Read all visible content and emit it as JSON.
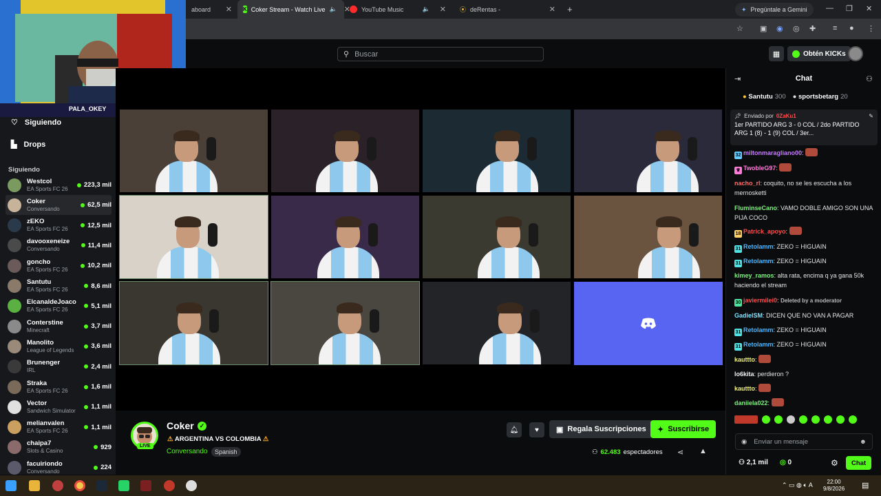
{
  "browser": {
    "tabs": [
      {
        "label": "aboard"
      },
      {
        "label": "Coker Stream - Watch Live"
      },
      {
        "label": "YouTube Music"
      },
      {
        "label": "deRentas -"
      }
    ],
    "gemini_label": "Pregúntale a Gemini"
  },
  "webcam": {
    "handle": "PALA_OKEY"
  },
  "header": {
    "search_placeholder": "Buscar",
    "kicks_button": "Obtén KICKs"
  },
  "sidebar": {
    "nav": [
      {
        "label": "Siguiendo"
      },
      {
        "label": "Drops"
      }
    ],
    "section_title": "Siguiendo",
    "following": [
      {
        "name": "Westcol",
        "category": "EA Sports FC 26",
        "viewers": "223,3 mil",
        "color": "#7a9a60"
      },
      {
        "name": "Coker",
        "category": "Conversando",
        "viewers": "62,5 mil",
        "color": "#c7b29a"
      },
      {
        "name": "zEKO",
        "category": "EA Sports FC 26",
        "viewers": "12,5 mil",
        "color": "#2a3a4a"
      },
      {
        "name": "davooxeneize",
        "category": "Conversando",
        "viewers": "11,4 mil",
        "color": "#4a4a4a"
      },
      {
        "name": "goncho",
        "category": "EA Sports FC 26",
        "viewers": "10,2 mil",
        "color": "#6a5a5a"
      },
      {
        "name": "Santutu",
        "category": "EA Sports FC 26",
        "viewers": "8,6 mil",
        "color": "#8a7a6a"
      },
      {
        "name": "ElcanaldeJoaco",
        "category": "EA Sports FC 26",
        "viewers": "5,1 mil",
        "color": "#5ab040"
      },
      {
        "name": "Conterstine",
        "category": "Minecraft",
        "viewers": "3,7 mil",
        "color": "#8a8a8a"
      },
      {
        "name": "Manolito",
        "category": "League of Legends",
        "viewers": "3,6 mil",
        "color": "#9a8a7a"
      },
      {
        "name": "Brunenger",
        "category": "IRL",
        "viewers": "2,4 mil",
        "color": "#3a3a3a"
      },
      {
        "name": "Straka",
        "category": "EA Sports FC 26",
        "viewers": "1,6 mil",
        "color": "#7a6a5a"
      },
      {
        "name": "Vector",
        "category": "Sandwich Simulator",
        "viewers": "1,1 mil",
        "color": "#e0e0e0"
      },
      {
        "name": "melianvalen",
        "category": "EA Sports FC 26",
        "viewers": "1,1 mil",
        "color": "#c9a060"
      },
      {
        "name": "chaipa7",
        "category": "Slots & Casino",
        "viewers": "929",
        "color": "#8a6a6a"
      },
      {
        "name": "facuiriondo",
        "category": "Conversando",
        "viewers": "224",
        "color": "#5a5a6a"
      }
    ]
  },
  "channel": {
    "name": "Coker",
    "live_badge": "LIVE",
    "title": "ARGENTINA VS COLOMBIA",
    "category": "Conversando",
    "language": "Spanish",
    "gift_button": "Regala Suscripciones",
    "subscribe_button": "Suscribirse",
    "viewers": "62.483",
    "viewers_label": "espectadores"
  },
  "chat": {
    "title": "Chat",
    "gifters": [
      {
        "name": "Santutu",
        "count": "300"
      },
      {
        "name": "sportsbetarg",
        "count": "20"
      }
    ],
    "pinned": {
      "sent_by_label": "Enviado por",
      "user": "0ZaKu1",
      "text": "1er PARTIDO ARG 3 - 0 COL / 2do PARTIDO ARG 1 (8) - 1 (9) COL / 3er..."
    },
    "messages": [
      {
        "user": "miltonmaragliano00",
        "text": "",
        "color": "#c77dff",
        "badge": "32",
        "badge_color": "#6cf"
      },
      {
        "user": "TwobleG97",
        "text": "",
        "color": "#ff7ad9",
        "badge": "♕",
        "badge_color": "#ff7ad9"
      },
      {
        "user": "nacho_rl",
        "text": "coquito, no se les escucha a los mernosketti",
        "color": "#ff6b6b",
        "badge": "",
        "badge_color": ""
      },
      {
        "user": "FluminseCano",
        "text": "VAMO DOBLE AMIGO SON UNA PIJA COCO",
        "color": "#7cf27c",
        "badge": "",
        "badge_color": ""
      },
      {
        "user": "Patrick_apoyo",
        "text": "",
        "color": "#ff4d4d",
        "badge": "18",
        "badge_color": "#ffd166"
      },
      {
        "user": "Retolamm",
        "text": "ZEKO = HIGUAIN",
        "color": "#4db8ff",
        "badge": "31",
        "badge_color": "#4fe3e3"
      },
      {
        "user": "Retolamm",
        "text": "ZEKO = HIGUAIN",
        "color": "#4db8ff",
        "badge": "31",
        "badge_color": "#4fe3e3"
      },
      {
        "user": "kimey_ramos",
        "text": "alta rata, encima q ya gana 50k haciendo el stream",
        "color": "#7cf27c",
        "badge": "",
        "badge_color": ""
      },
      {
        "user": "javiermilei0",
        "text": "Deleted by a moderator",
        "color": "#ff4d4d",
        "badge": "30",
        "badge_color": "#4fe3a0"
      },
      {
        "user": "GadielSM",
        "text": "DICEN QUE NO VAN A PAGAR",
        "color": "#7ce3ff",
        "badge": "",
        "badge_color": ""
      },
      {
        "user": "Retolamm",
        "text": "ZEKO = HIGUAIN",
        "color": "#4db8ff",
        "badge": "31",
        "badge_color": "#4fe3e3"
      },
      {
        "user": "Retolamm",
        "text": "ZEKO = HIGUAIN",
        "color": "#4db8ff",
        "badge": "31",
        "badge_color": "#4fe3e3"
      },
      {
        "user": "kauttto",
        "text": "",
        "color": "#f2f27c",
        "badge": "",
        "badge_color": ""
      },
      {
        "user": "lo6kita",
        "text": "perdieron ?",
        "color": "#f2f2f2",
        "badge": "",
        "badge_color": ""
      },
      {
        "user": "kauttto",
        "text": "",
        "color": "#f2f27c",
        "badge": "",
        "badge_color": ""
      },
      {
        "user": "daniiela022",
        "text": "",
        "color": "#7cf27c",
        "badge": "",
        "badge_color": ""
      }
    ],
    "input_placeholder": "Enviar un mensaje",
    "kicks_count": "2,1 mil",
    "points": "0",
    "send_button": "Chat"
  },
  "taskbar": {
    "time": "22:00",
    "date": "9/8/2026"
  },
  "colors": {
    "accent": "#53fc18",
    "background": "#0b0c0e",
    "sidebar": "#17181b"
  }
}
